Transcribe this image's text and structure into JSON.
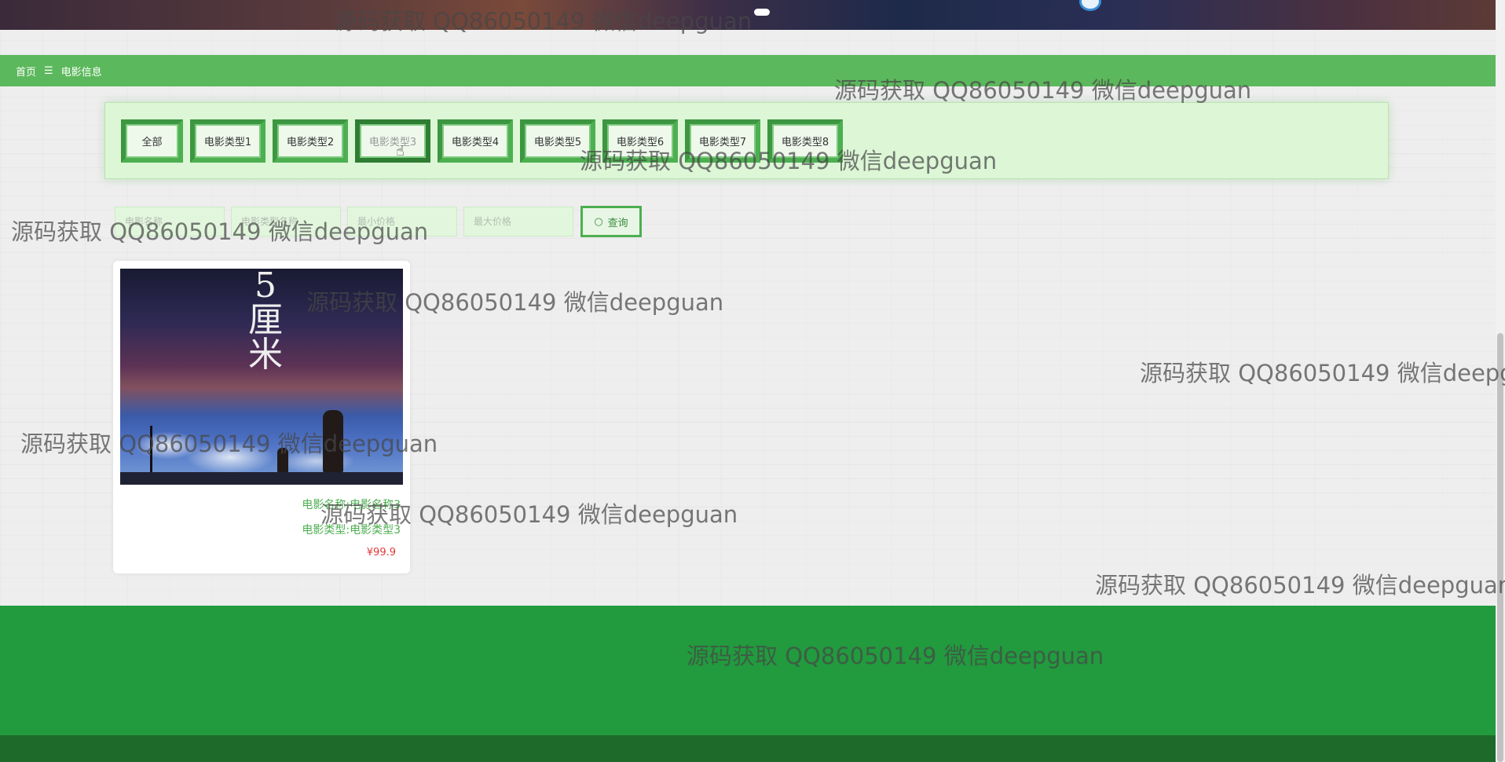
{
  "breadcrumb": {
    "home": "首页",
    "separator": "☰",
    "current": "电影信息"
  },
  "type_filters": [
    "全部",
    "电影类型1",
    "电影类型2",
    "电影类型3",
    "电影类型4",
    "电影类型5",
    "电影类型6",
    "电影类型7",
    "电影类型8"
  ],
  "active_type_index": 3,
  "search": {
    "name_placeholder": "电影名称",
    "type_placeholder": "电影类型名称",
    "min_price_placeholder": "最小价格",
    "max_price_placeholder": "最大价格",
    "query_label": "查询",
    "query_icon": "search-icon"
  },
  "movie_card": {
    "name": "电影名称:电影名称3",
    "type": "电影类型:电影类型3",
    "price": "¥99.9",
    "poster_title": "5 厘米"
  },
  "watermark": "源码获取 QQ86050149 微信deepguan",
  "colors": {
    "primary_green": "#5cb85c",
    "footer_green": "#229a3e",
    "price_red": "#e03b3b"
  }
}
